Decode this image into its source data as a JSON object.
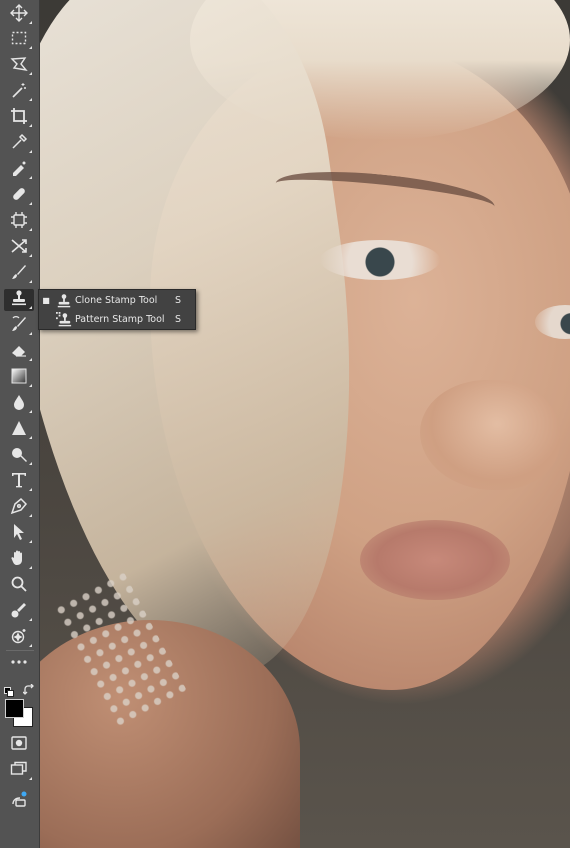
{
  "toolbar": {
    "tools": [
      {
        "name": "move-tool",
        "icon": "move-icon"
      },
      {
        "name": "marquee-tool",
        "icon": "rectangular-marquee-icon"
      },
      {
        "name": "lasso-tool",
        "icon": "polygonal-lasso-icon"
      },
      {
        "name": "magic-wand-tool",
        "icon": "magic-wand-icon"
      },
      {
        "name": "crop-tool",
        "icon": "crop-icon"
      },
      {
        "name": "eyedropper-tool",
        "icon": "eyedropper-icon"
      },
      {
        "name": "spot-healing-tool",
        "icon": "spot-healing-brush-icon"
      },
      {
        "name": "healing-brush-tool",
        "icon": "bandage-icon"
      },
      {
        "name": "patch-tool",
        "icon": "patch-icon"
      },
      {
        "name": "content-aware-move-tool",
        "icon": "content-aware-move-icon"
      },
      {
        "name": "brush-tool",
        "icon": "brush-icon"
      },
      {
        "name": "clone-stamp-tool",
        "icon": "clone-stamp-icon",
        "active": true
      },
      {
        "name": "history-brush-tool",
        "icon": "history-brush-icon"
      },
      {
        "name": "eraser-tool",
        "icon": "eraser-icon"
      },
      {
        "name": "gradient-tool",
        "icon": "gradient-icon"
      },
      {
        "name": "blur-tool",
        "icon": "blur-drop-icon"
      },
      {
        "name": "sharpen-tool",
        "icon": "sharpen-icon"
      },
      {
        "name": "dodge-tool",
        "icon": "dodge-icon"
      },
      {
        "name": "type-tool",
        "icon": "type-icon"
      },
      {
        "name": "pen-tool",
        "icon": "pen-icon"
      },
      {
        "name": "path-selection-tool",
        "icon": "path-selection-arrow-icon"
      },
      {
        "name": "hand-tool",
        "icon": "hand-icon"
      },
      {
        "name": "zoom-tool",
        "icon": "zoom-icon"
      },
      {
        "name": "remove-tool",
        "icon": "remove-tool-icon"
      },
      {
        "name": "generative-tool",
        "icon": "sparkle-brush-icon"
      },
      {
        "name": "more-tools",
        "icon": "ellipsis-icon"
      }
    ],
    "colors": {
      "foreground": "#000000",
      "background": "#ffffff"
    },
    "bottom": [
      "quick-mask-icon",
      "screen-mode-icon",
      "share-icon"
    ]
  },
  "flyout": {
    "items": [
      {
        "label": "Clone Stamp Tool",
        "shortcut": "S",
        "selected": true,
        "icon": "clone-stamp-icon"
      },
      {
        "label": "Pattern Stamp Tool",
        "shortcut": "S",
        "selected": false,
        "icon": "pattern-stamp-icon"
      }
    ]
  },
  "colors": {
    "ui_dark": "#535353",
    "flyout_bg": "#424242",
    "text": "#e8e8e8"
  }
}
